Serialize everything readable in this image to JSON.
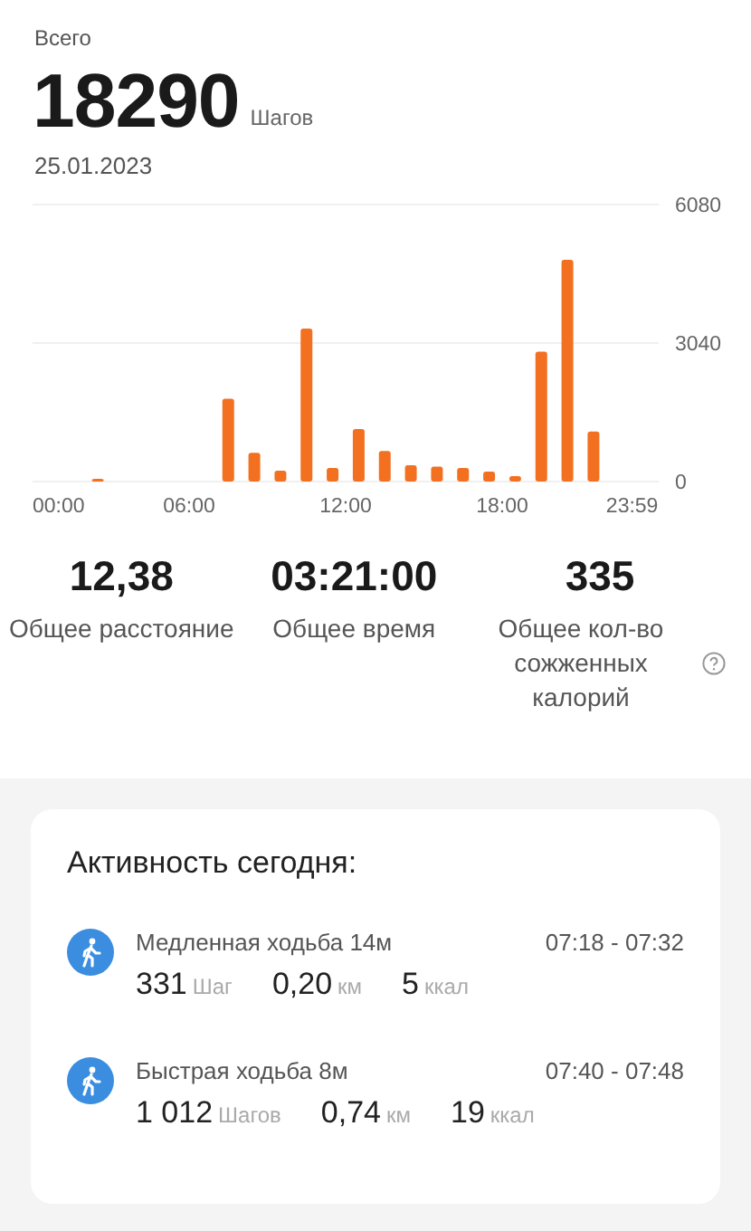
{
  "summary": {
    "label": "Всего",
    "steps": "18290",
    "unit": "Шагов",
    "date": "25.01.2023"
  },
  "chart_data": {
    "type": "bar",
    "x": [
      0.5,
      1.5,
      2.5,
      3.5,
      4.5,
      5.5,
      6.5,
      7.5,
      8.5,
      9.5,
      10.5,
      11.5,
      12.5,
      13.5,
      14.5,
      15.5,
      16.5,
      17.5,
      18.5,
      19.5,
      20.5,
      21.5,
      22.5,
      23.5
    ],
    "xlim": [
      0,
      24
    ],
    "series": [
      {
        "color": "#f37021",
        "values": [
          0,
          0,
          20,
          0,
          0,
          0,
          0,
          1820,
          630,
          240,
          3360,
          300,
          1150,
          670,
          360,
          330,
          300,
          220,
          120,
          2850,
          4870,
          1100,
          0,
          0
        ]
      }
    ],
    "ylim": [
      0,
      6080
    ],
    "yticks": [
      0,
      3040,
      6080
    ],
    "xticks": [
      {
        "value": 0,
        "label": "00:00"
      },
      {
        "value": 6,
        "label": "06:00"
      },
      {
        "value": 12,
        "label": "12:00"
      },
      {
        "value": 18,
        "label": "18:00"
      },
      {
        "value": 23.98,
        "label": "23:59"
      }
    ]
  },
  "stats": [
    {
      "value": "12,38",
      "label": "Общее расстояние"
    },
    {
      "value": "03:21:00",
      "label": "Общее время"
    },
    {
      "value": "335",
      "label": "Общее кол-во сожженных калорий",
      "help": true
    }
  ],
  "activity": {
    "title": "Активность сегодня:",
    "items": [
      {
        "name": "Медленная ходьба 14м",
        "time": "07:18 - 07:32",
        "steps": "331",
        "steps_unit": "Шаг",
        "distance": "0,20",
        "distance_unit": "км",
        "calories": "5",
        "calories_unit": "ккал"
      },
      {
        "name": "Быстрая ходьба 8м",
        "time": "07:40 - 07:48",
        "steps": "1 012",
        "steps_unit": "Шагов",
        "distance": "0,74",
        "distance_unit": "км",
        "calories": "19",
        "calories_unit": "ккал"
      }
    ]
  }
}
